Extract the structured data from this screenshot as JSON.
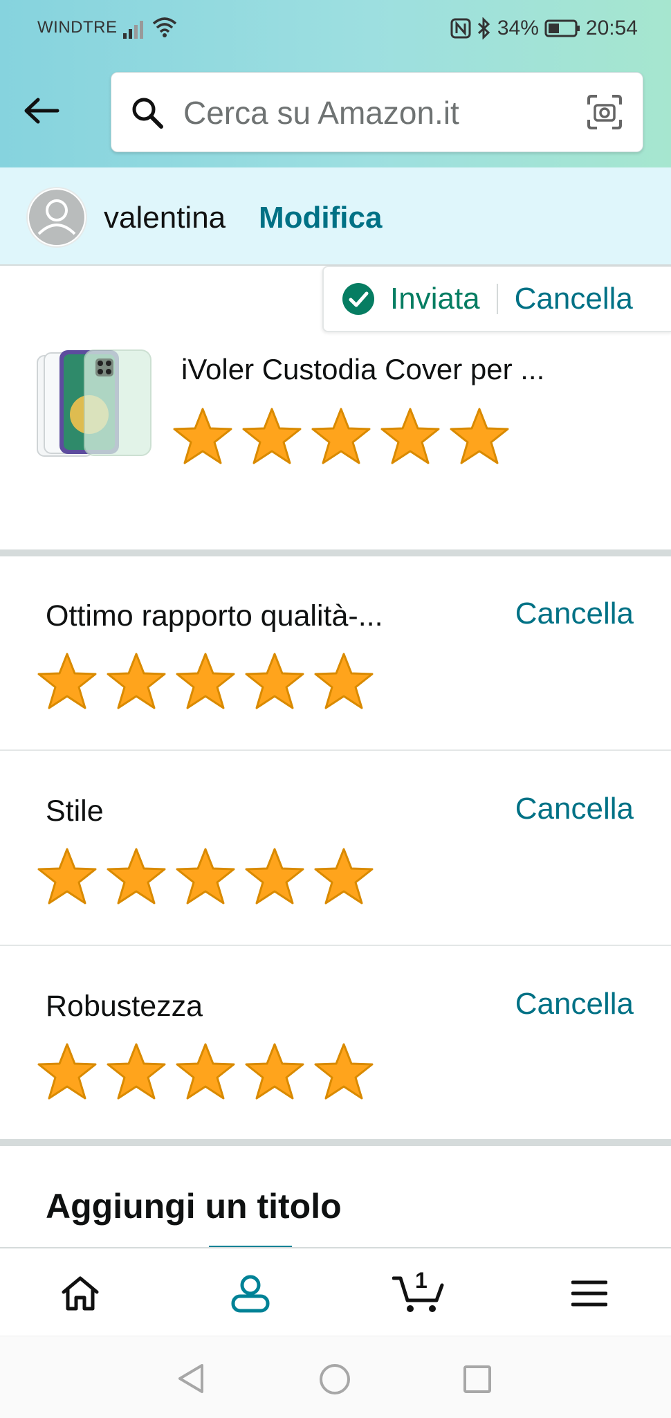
{
  "status_bar": {
    "carrier": "WINDTRE",
    "battery": "34%",
    "time": "20:54"
  },
  "search": {
    "placeholder": "Cerca su Amazon.it"
  },
  "account": {
    "name": "valentina",
    "edit_label": "Modifica"
  },
  "review_status": {
    "status_label": "Inviata",
    "cancel_label": "Cancella"
  },
  "product": {
    "title": "iVoler Custodia Cover per ...",
    "rating": 5,
    "rating_max": 5
  },
  "attributes": [
    {
      "label": "Ottimo rapporto qualità-...",
      "cancel_label": "Cancella",
      "rating": 5
    },
    {
      "label": "Stile",
      "cancel_label": "Cancella",
      "rating": 5
    },
    {
      "label": "Robustezza",
      "cancel_label": "Cancella",
      "rating": 5
    }
  ],
  "add_title": "Aggiungi un titolo",
  "bottom_nav": {
    "items": [
      "home-icon",
      "account-icon",
      "cart-icon",
      "menu-icon"
    ],
    "active": "account-icon",
    "cart_count": "1"
  },
  "colors": {
    "link": "#007185",
    "success": "#067d62",
    "star": "#ffa41c",
    "nav_indicator": "#008296"
  }
}
